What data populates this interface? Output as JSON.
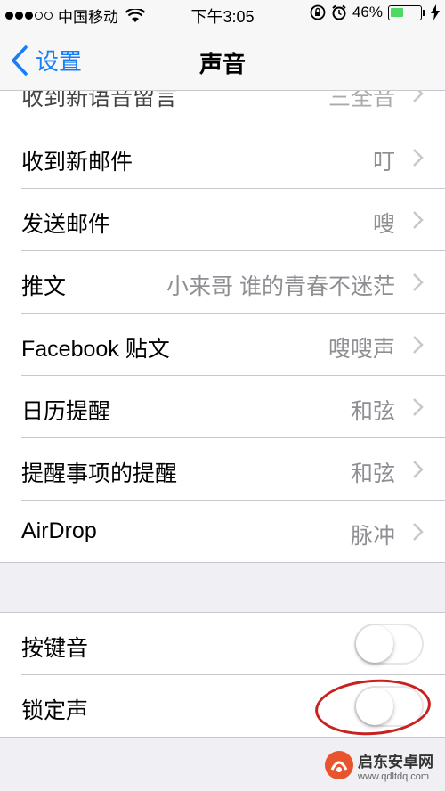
{
  "status_bar": {
    "carrier": "中国移动",
    "time": "下午3:05",
    "battery": "46%",
    "battery_level": 0.46,
    "icons": [
      "signal-dots-icon",
      "wifi-icon",
      "rotation-lock-icon",
      "alarm-icon",
      "battery-icon",
      "charging-icon"
    ]
  },
  "nav": {
    "back_label": "设置",
    "title": "声音"
  },
  "rows": [
    {
      "label": "收到新语音留言",
      "value": "三全音"
    },
    {
      "label": "收到新邮件",
      "value": "叮"
    },
    {
      "label": "发送邮件",
      "value": "嗖"
    },
    {
      "label": "推文",
      "value": "小来哥 谁的青春不迷茫"
    },
    {
      "label": "Facebook 贴文",
      "value": "嗖嗖声"
    },
    {
      "label": "日历提醒",
      "value": "和弦"
    },
    {
      "label": "提醒事项的提醒",
      "value": "和弦"
    },
    {
      "label": "AirDrop",
      "value": "脉冲"
    }
  ],
  "toggles": [
    {
      "label": "按键音",
      "on": false
    },
    {
      "label": "锁定声",
      "on": false
    }
  ],
  "watermark": {
    "name": "启东安卓网",
    "url": "www.qdltdq.com"
  },
  "colors": {
    "accent": "#157efb",
    "annotation": "#c9211e",
    "battery": "#4cd964"
  }
}
